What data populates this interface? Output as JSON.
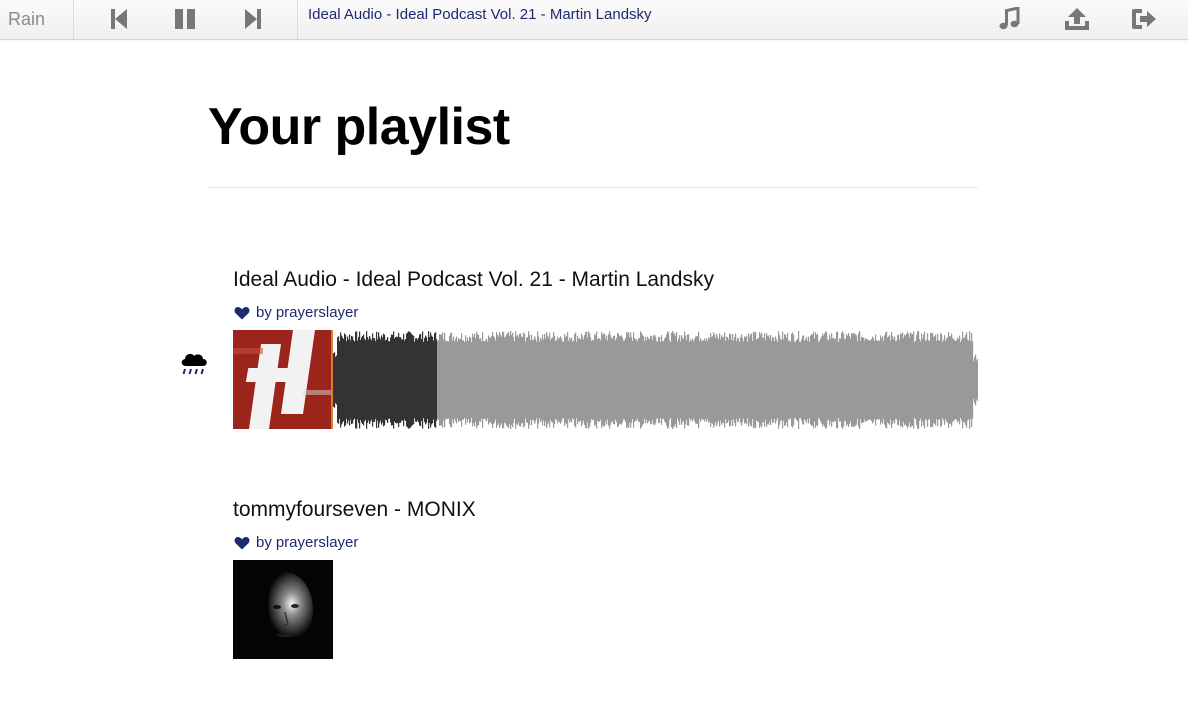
{
  "app": {
    "brand": "Rain"
  },
  "player": {
    "now_playing": "Ideal Audio - Ideal Podcast Vol. 21 - Martin Landsky",
    "controls": [
      "previous-icon",
      "pause-icon",
      "next-icon"
    ],
    "right_actions": [
      "music-note-icon",
      "upload-icon",
      "logout-icon"
    ],
    "played_fraction": 0.16
  },
  "page": {
    "title": "Your playlist"
  },
  "tracks": [
    {
      "title": "Ideal Audio - Ideal Podcast Vol. 21 - Martin Landsky",
      "by_label": "by",
      "user": "prayerslayer",
      "liked": true,
      "playing": true,
      "playing_icon": "rain-cloud-icon"
    },
    {
      "title": "tommyfourseven - MONIX",
      "by_label": "by",
      "user": "prayerslayer",
      "liked": true,
      "playing": false
    }
  ],
  "colors": {
    "accent": "#1f2a6e",
    "heart": "#1f2a6e",
    "icon_gray": "#777777",
    "wave_played": "#333333",
    "wave_unplayed": "#999999",
    "playhead": "#e07a2a",
    "artwork_red": "#a8281e"
  }
}
